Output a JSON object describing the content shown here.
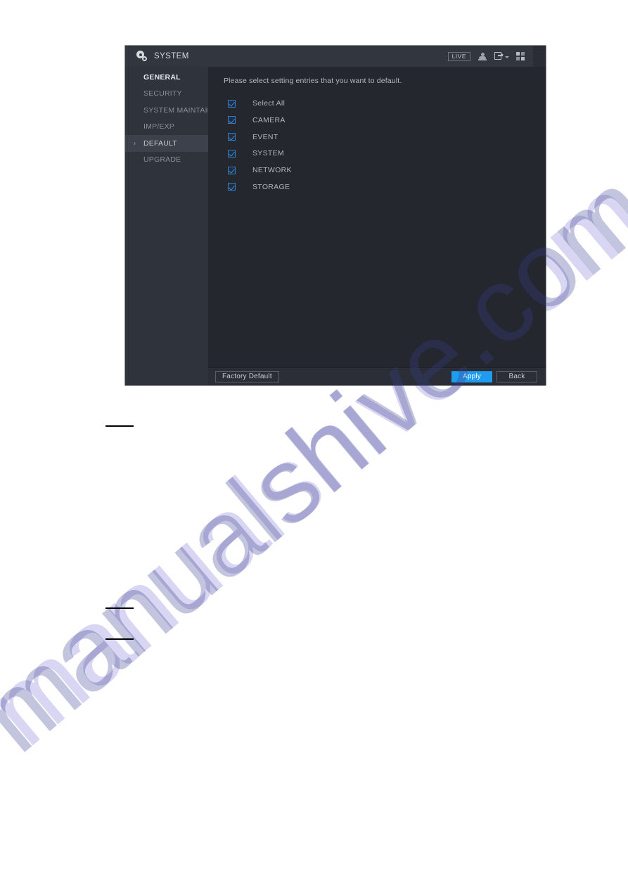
{
  "page": {
    "watermark": "manualshive.com"
  },
  "dialog": {
    "title": "SYSTEM",
    "title_icon": "gear-icon",
    "toolbar": {
      "live_badge": "LIVE",
      "user_icon": "user-icon",
      "logout_icon": "logout-icon",
      "logout_caret_icon": "caret-down-icon",
      "grid_icon": "grid-apps-icon"
    },
    "sidebar": {
      "items": [
        {
          "label": "GENERAL",
          "state": "bold"
        },
        {
          "label": "SECURITY",
          "state": "normal"
        },
        {
          "label": "SYSTEM MAINTAIN",
          "state": "normal"
        },
        {
          "label": "IMP/EXP",
          "state": "normal"
        },
        {
          "label": "DEFAULT",
          "state": "selected",
          "chevron": "›"
        },
        {
          "label": "UPGRADE",
          "state": "normal"
        }
      ]
    },
    "content": {
      "instruction": "Please select setting entries that you want to default.",
      "checkboxes": [
        {
          "label": "Select All",
          "checked": true
        },
        {
          "label": "CAMERA",
          "checked": true
        },
        {
          "label": "EVENT",
          "checked": true
        },
        {
          "label": "SYSTEM",
          "checked": true
        },
        {
          "label": "NETWORK",
          "checked": true
        },
        {
          "label": "STORAGE",
          "checked": true
        }
      ]
    },
    "footer": {
      "factory_default_label": "Factory Default",
      "apply_label": "Apply",
      "back_label": "Back"
    }
  },
  "colors": {
    "accent_blue": "#1f9bf0",
    "checkbox_blue": "#2b7fd4",
    "titlebar_bg": "#32363f",
    "sidebar_bg": "#2f333c",
    "content_bg": "#24272e",
    "watermark": "#b9b6e8"
  }
}
